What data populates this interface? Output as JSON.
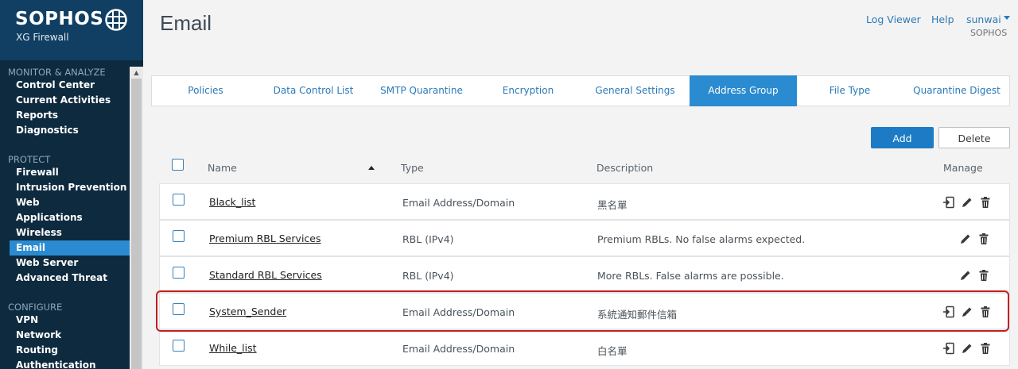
{
  "brand": {
    "logo": "SOPHOS",
    "product": "XG Firewall"
  },
  "sidebar": {
    "sections": [
      {
        "label": "MONITOR & ANALYZE",
        "items": [
          "Control Center",
          "Current Activities",
          "Reports",
          "Diagnostics"
        ]
      },
      {
        "label": "PROTECT",
        "items": [
          "Firewall",
          "Intrusion Prevention",
          "Web",
          "Applications",
          "Wireless",
          "Email",
          "Web Server",
          "Advanced Threat"
        ]
      },
      {
        "label": "CONFIGURE",
        "items": [
          "VPN",
          "Network",
          "Routing",
          "Authentication"
        ]
      }
    ],
    "active_item": "Email"
  },
  "header": {
    "title": "Email",
    "log_viewer": "Log Viewer",
    "help": "Help",
    "user": "sunwai",
    "org": "SOPHOS"
  },
  "tabs": [
    "Policies",
    "Data Control List",
    "SMTP Quarantine",
    "Encryption",
    "General Settings",
    "Address Group",
    "File Type",
    "Quarantine Digest"
  ],
  "active_tab": "Address Group",
  "actions": {
    "add": "Add",
    "delete": "Delete"
  },
  "table": {
    "columns": {
      "name": "Name",
      "type": "Type",
      "description": "Description",
      "manage": "Manage"
    },
    "rows": [
      {
        "name": "Black_list",
        "type": "Email Address/Domain",
        "description": "黑名單",
        "import_icon": true
      },
      {
        "name": "Premium RBL Services",
        "type": "RBL (IPv4)",
        "description": "Premium RBLs. No false alarms expected.",
        "import_icon": false
      },
      {
        "name": "Standard RBL Services",
        "type": "RBL (IPv4)",
        "description": "More RBLs. False alarms are possible.",
        "import_icon": false
      },
      {
        "name": "System_Sender",
        "type": "Email Address/Domain",
        "description": "系統通知郵件信箱",
        "import_icon": true
      },
      {
        "name": "While_list",
        "type": "Email Address/Domain",
        "description": "白名單",
        "import_icon": true
      }
    ],
    "highlighted_row": "System_Sender"
  },
  "colors": {
    "accent": "#2a8bd0",
    "sidebar_bg": "#0e2a3f",
    "highlight": "#c41e1e"
  }
}
